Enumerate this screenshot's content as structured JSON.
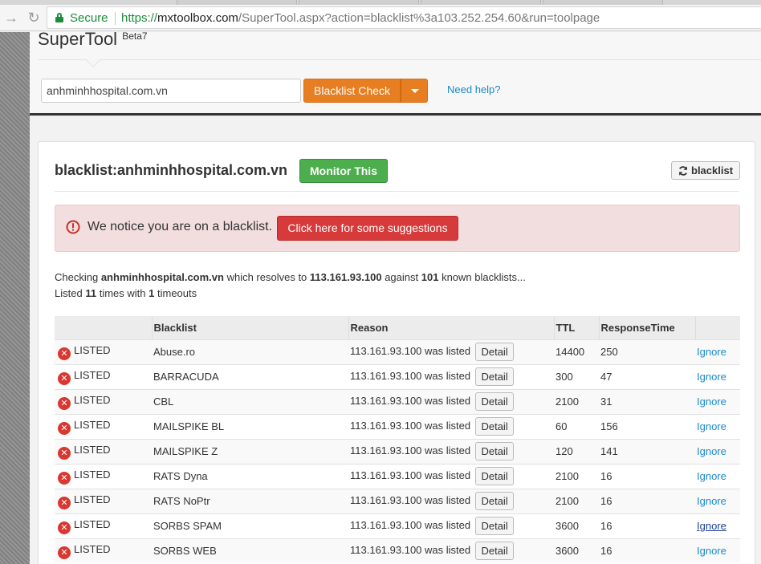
{
  "browser": {
    "secure_label": "Secure",
    "url_scheme": "https://",
    "url_host": "mxtoolbox.com",
    "url_path": "/SuperTool.aspx?action=blacklist%3a103.252.254.60&run=toolpage"
  },
  "header": {
    "brand": "SuperTool",
    "brand_sup": "Beta7",
    "search_value": "anhminhhospital.com.vn",
    "check_label": "Blacklist Check",
    "help_label": "Need help?"
  },
  "panel": {
    "title": "blacklist:anhminhhospital.com.vn",
    "monitor_label": "Monitor This",
    "refresh_label": "blacklist",
    "alert_text": "We notice you are on a blacklist.",
    "suggest_label": "Click here for some suggestions",
    "summary": {
      "checking": "Checking",
      "domain": "anhminhhospital.com.vn",
      "resolves": "which resolves to",
      "ip": "113.161.93.100",
      "against": "against",
      "count": "101",
      "known": "known blacklists...",
      "listed": "Listed",
      "listed_count": "11",
      "times_with": "times with",
      "timeouts_count": "1",
      "timeouts": "timeouts"
    }
  },
  "table": {
    "headers": [
      "",
      "Blacklist",
      "Reason",
      "TTL",
      "ResponseTime",
      ""
    ],
    "detail_label": "Detail",
    "ignore_label": "Ignore",
    "rows": [
      {
        "status": "LISTED",
        "blacklist": "Abuse.ro",
        "reason": "113.161.93.100 was listed",
        "ttl": "14400",
        "response": "250"
      },
      {
        "status": "LISTED",
        "blacklist": "BARRACUDA",
        "reason": "113.161.93.100 was listed",
        "ttl": "300",
        "response": "47"
      },
      {
        "status": "LISTED",
        "blacklist": "CBL",
        "reason": "113.161.93.100 was listed",
        "ttl": "2100",
        "response": "31"
      },
      {
        "status": "LISTED",
        "blacklist": "MAILSPIKE BL",
        "reason": "113.161.93.100 was listed",
        "ttl": "60",
        "response": "156"
      },
      {
        "status": "LISTED",
        "blacklist": "MAILSPIKE Z",
        "reason": "113.161.93.100 was listed",
        "ttl": "120",
        "response": "141"
      },
      {
        "status": "LISTED",
        "blacklist": "RATS Dyna",
        "reason": "113.161.93.100 was listed",
        "ttl": "2100",
        "response": "16"
      },
      {
        "status": "LISTED",
        "blacklist": "RATS NoPtr",
        "reason": "113.161.93.100 was listed",
        "ttl": "2100",
        "response": "16"
      },
      {
        "status": "LISTED",
        "blacklist": "SORBS SPAM",
        "reason": "113.161.93.100 was listed",
        "ttl": "3600",
        "response": "16"
      },
      {
        "status": "LISTED",
        "blacklist": "SORBS WEB",
        "reason": "113.161.93.100 was listed",
        "ttl": "3600",
        "response": "16"
      }
    ]
  },
  "colors": {
    "accent_orange": "#e87e22",
    "monitor_green": "#4cae4c",
    "alert_red": "#d63a3a",
    "link_blue": "#1a8ac8"
  }
}
